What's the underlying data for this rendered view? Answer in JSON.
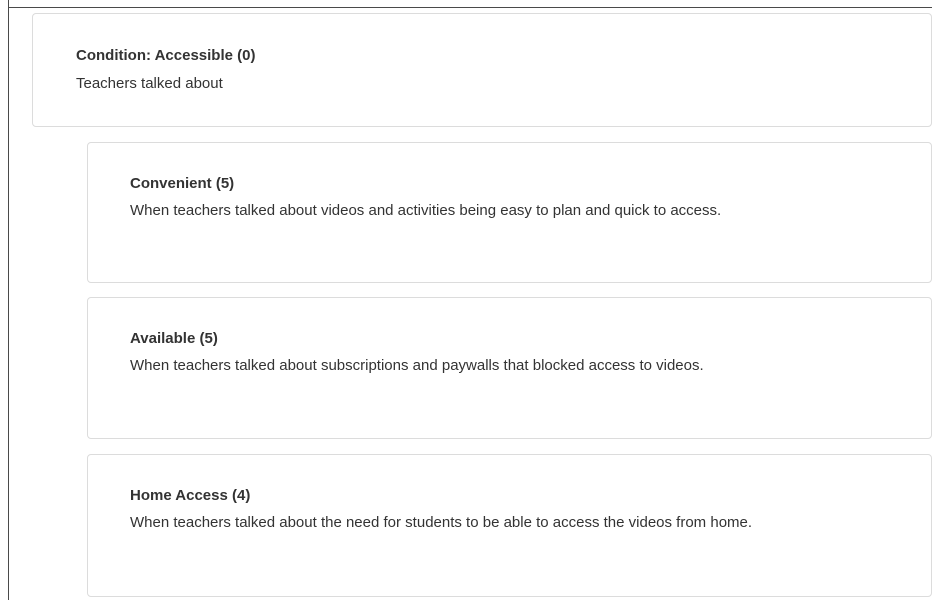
{
  "condition": {
    "title": "Condition: Accessible (0)",
    "description": "Teachers talked about"
  },
  "codes": [
    {
      "title": "Convenient (5)",
      "description": "When teachers talked about videos and activities being easy to plan and quick to access."
    },
    {
      "title": "Available (5)",
      "description": "When teachers talked about subscriptions and paywalls that blocked access to videos."
    },
    {
      "title": "Home Access (4)",
      "description": "When teachers talked about the need for students to be able to access the videos from home."
    }
  ]
}
